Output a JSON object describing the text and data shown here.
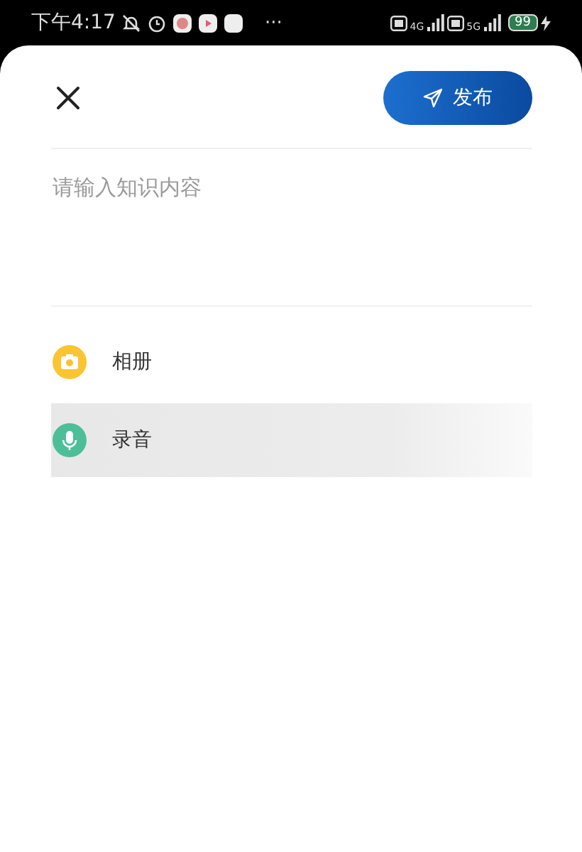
{
  "status_bar": {
    "time": "下午4:17",
    "more": "···",
    "network_1": "4G",
    "network_2": "5G",
    "battery": "99"
  },
  "header": {
    "publish_button": "发布"
  },
  "editor": {
    "placeholder": "请输入知识内容"
  },
  "attachments": [
    {
      "kind": "camera",
      "label": "相册",
      "color": "#fbc531",
      "selected": false
    },
    {
      "kind": "mic",
      "label": "录音",
      "color": "#4cbf98",
      "selected": true
    }
  ]
}
